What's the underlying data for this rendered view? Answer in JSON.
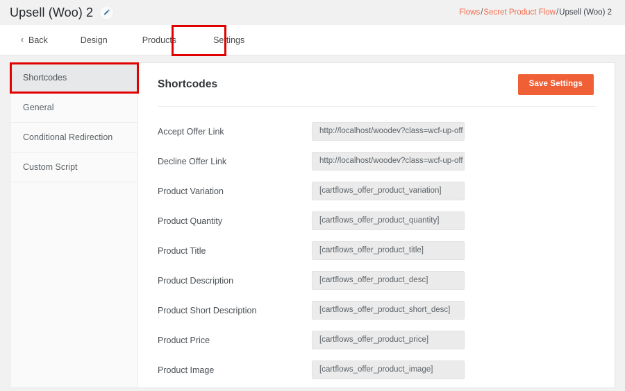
{
  "header": {
    "title": "Upsell (Woo) 2",
    "edit_icon": "pencil-icon",
    "breadcrumb": {
      "items": [
        {
          "label": "Flows",
          "link": true
        },
        {
          "label": "Secret Product Flow",
          "link": true
        },
        {
          "label": "Upsell (Woo) 2",
          "link": false
        }
      ],
      "separator": "/"
    },
    "link_color": "#f26b4c"
  },
  "tabs": {
    "back_label": "Back",
    "back_icon": "chevron-left-icon",
    "items": [
      {
        "label": "Design",
        "active": false
      },
      {
        "label": "Products",
        "active": false
      },
      {
        "label": "Settings",
        "active": true
      }
    ]
  },
  "sidebar": {
    "items": [
      {
        "label": "Shortcodes",
        "active": true
      },
      {
        "label": "General",
        "active": false
      },
      {
        "label": "Conditional Redirection",
        "active": false
      },
      {
        "label": "Custom Script",
        "active": false
      }
    ]
  },
  "panel": {
    "title": "Shortcodes",
    "save_label": "Save Settings",
    "save_color": "#ef6036",
    "fields": [
      {
        "label": "Accept Offer Link",
        "value": "http://localhost/woodev?class=wcf-up-off"
      },
      {
        "label": "Decline Offer Link",
        "value": "http://localhost/woodev?class=wcf-up-off"
      },
      {
        "label": "Product Variation",
        "value": "[cartflows_offer_product_variation]"
      },
      {
        "label": "Product Quantity",
        "value": "[cartflows_offer_product_quantity]"
      },
      {
        "label": "Product Title",
        "value": "[cartflows_offer_product_title]"
      },
      {
        "label": "Product Description",
        "value": "[cartflows_offer_product_desc]"
      },
      {
        "label": "Product Short Description",
        "value": "[cartflows_offer_product_short_desc]"
      },
      {
        "label": "Product Price",
        "value": "[cartflows_offer_product_price]"
      },
      {
        "label": "Product Image",
        "value": "[cartflows_offer_product_image]"
      }
    ]
  },
  "annotations": {
    "color": "#e00000",
    "boxes": [
      {
        "target": "tab-settings"
      },
      {
        "target": "sidebar-item-shortcodes"
      }
    ]
  }
}
